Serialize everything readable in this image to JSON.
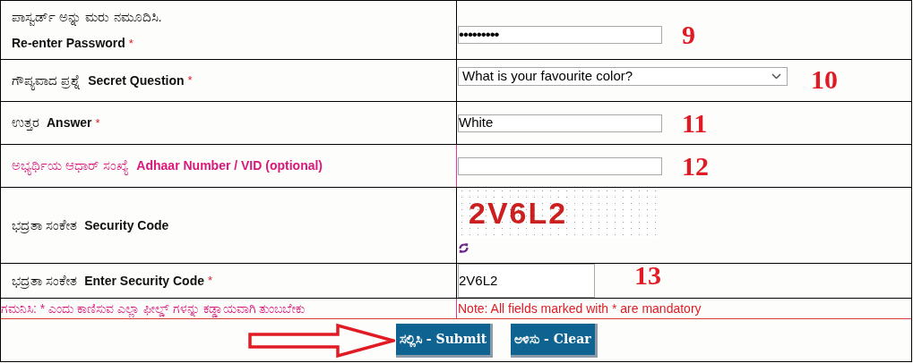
{
  "rows": [
    {
      "label_kn": "ಪಾಸ್ವರ್ಡ್ ಅನ್ನು ಮರು ನಮೂದಿಸಿ.",
      "label_en": "Re-enter Password",
      "required_mark": "*",
      "highlighted": false,
      "field": {
        "kind": "password",
        "value": "•••••••••"
      },
      "annotation": "9"
    },
    {
      "label_kn": "ಗೌಪ್ಯವಾದ  ಪ್ರಶ್ನೆ",
      "label_en": "Secret Question",
      "required_mark": "*",
      "highlighted": false,
      "field": {
        "kind": "select",
        "value": "What is your favourite color?"
      },
      "annotation": "10"
    },
    {
      "label_kn": "ಉತ್ತರ",
      "label_en": "Answer",
      "required_mark": "*",
      "highlighted": false,
      "field": {
        "kind": "text",
        "value": "White"
      },
      "annotation": "11"
    },
    {
      "label_kn": "ಅಭ್ಯರ್ಥಿಯ ಆಧಾರ್ ಸಂಖ್ಯೆ",
      "label_en": "Adhaar Number / VID (optional)",
      "highlighted": true,
      "field": {
        "kind": "text"
      },
      "annotation": "12"
    },
    {
      "label_kn": "ಭದ್ರತಾ ಸಂಕೇತ",
      "label_en": "Security Code",
      "highlighted": false,
      "field": {
        "kind": "captcha",
        "value": "2V6L2"
      }
    },
    {
      "label_kn": "ಭದ್ರತಾ ಸಂಕೇತ",
      "label_en": "Enter Security Code",
      "required_mark": "*",
      "highlighted": false,
      "field": {
        "kind": "code",
        "value": "2V6L2"
      },
      "annotation": "13"
    }
  ],
  "note": {
    "kn": "ಗಮನಿಸಿ: * ಎಂದು ಕಾಣಿಸುವ ಎಲ್ಲಾ ಫೀಲ್ಡ್ ಗಳನ್ನು ಕಡ್ಡಾಯವಾಗಿ ತುಂಬಬೇಕು",
    "en": "Note: All fields marked with * are mandatory"
  },
  "pointer": {
    "kind": "arrow"
  },
  "buttons": [
    {
      "label": "ಸಲ್ಲಿಸಿ - Submit"
    },
    {
      "label": "ಅಳಿಸು - Clear"
    }
  ]
}
